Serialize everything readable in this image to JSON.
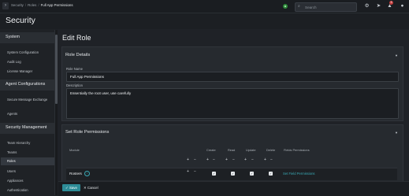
{
  "topbar": {
    "breadcrumb": [
      "Security",
      "Roles",
      "Full App Permissions"
    ],
    "search_placeholder": "Search",
    "notification_count": "5"
  },
  "header": {
    "title": "Security"
  },
  "sidebar": {
    "sections": [
      {
        "title": "System",
        "items": [
          "System Configuration",
          "Audit Log",
          "License Manager"
        ]
      },
      {
        "title": "Agent Configurations",
        "items": [
          "Secure Message Exchange",
          "Agents"
        ]
      },
      {
        "title": "Security Management",
        "items": [
          "Team Hierarchy",
          "Teams",
          "Roles",
          "Users",
          "Appliances",
          "Authentication"
        ]
      }
    ],
    "selected": "Roles"
  },
  "main": {
    "title": "Edit Role",
    "role_details": {
      "heading": "Role Details",
      "role_name_label": "Role Name",
      "role_name_value": "Full App Permissions",
      "description_label": "Description",
      "description_value": "Essentially the root user, use carefully"
    },
    "permissions": {
      "heading": "Set Role Permissions",
      "columns": [
        "Module",
        "Create",
        "Read",
        "Update",
        "Delete",
        "Fields Permissions"
      ],
      "rows": [
        {
          "module": "Rosters",
          "create": true,
          "read": true,
          "update": true,
          "delete": true,
          "link": "Set Field Permissions"
        }
      ]
    }
  },
  "footer": {
    "save_label": "Save",
    "cancel_label": "Cancel"
  },
  "colors": {
    "accent": "#2d8c97",
    "link": "#3aa9b5",
    "status": "#2e8b3a"
  }
}
